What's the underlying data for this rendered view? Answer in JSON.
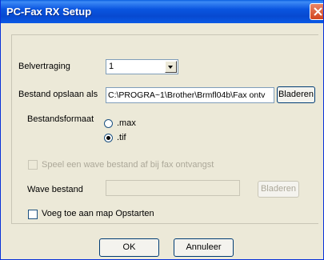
{
  "window": {
    "title": "PC-Fax RX Setup"
  },
  "ring_delay": {
    "label": "Belvertraging",
    "value": "1"
  },
  "save_file": {
    "label": "Bestand opslaan als",
    "value": "C:\\PROGRA~1\\Brother\\Brmfl04b\\Fax ontv",
    "browse_label": "Bladeren"
  },
  "file_format": {
    "label": "Bestandsformaat",
    "options": [
      ".max",
      ".tif"
    ],
    "selected": ".tif"
  },
  "play_wave": {
    "label": "Speel een wave bestand af bij fax ontvangst",
    "checked": false,
    "enabled": false
  },
  "wave_file": {
    "label": "Wave bestand",
    "value": "",
    "browse_label": "Bladeren",
    "enabled": false
  },
  "startup": {
    "label": "Voeg toe aan map Opstarten",
    "checked": false
  },
  "footer": {
    "ok_label": "OK",
    "cancel_label": "Annuleer"
  }
}
